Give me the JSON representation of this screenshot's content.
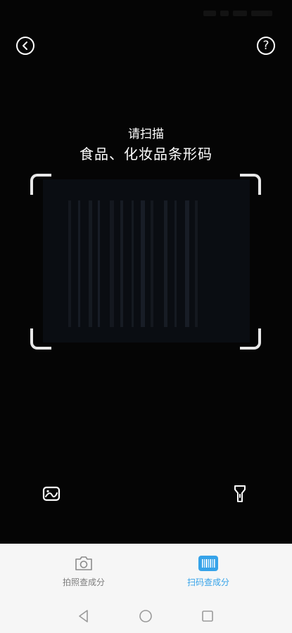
{
  "scanner": {
    "prompt_line1": "请扫描",
    "prompt_line2": "食品、化妆品条形码"
  },
  "tabs": [
    {
      "label": "拍照查成分",
      "icon": "camera-icon",
      "active": false
    },
    {
      "label": "扫码查成分",
      "icon": "barcode-icon",
      "active": true
    }
  ],
  "colors": {
    "background": "#060606",
    "accent": "#36a3e9",
    "inactive_tab": "#7d7d7d",
    "tab_bar_bg": "#f6f6f6"
  },
  "icons": {
    "back": "chevron-left-icon",
    "help": "question-icon",
    "album": "gallery-icon",
    "torch": "flashlight-icon",
    "nav_back": "triangle-back-icon",
    "nav_home": "circle-home-icon",
    "nav_recent": "square-recent-icon"
  },
  "help_glyph": "?"
}
